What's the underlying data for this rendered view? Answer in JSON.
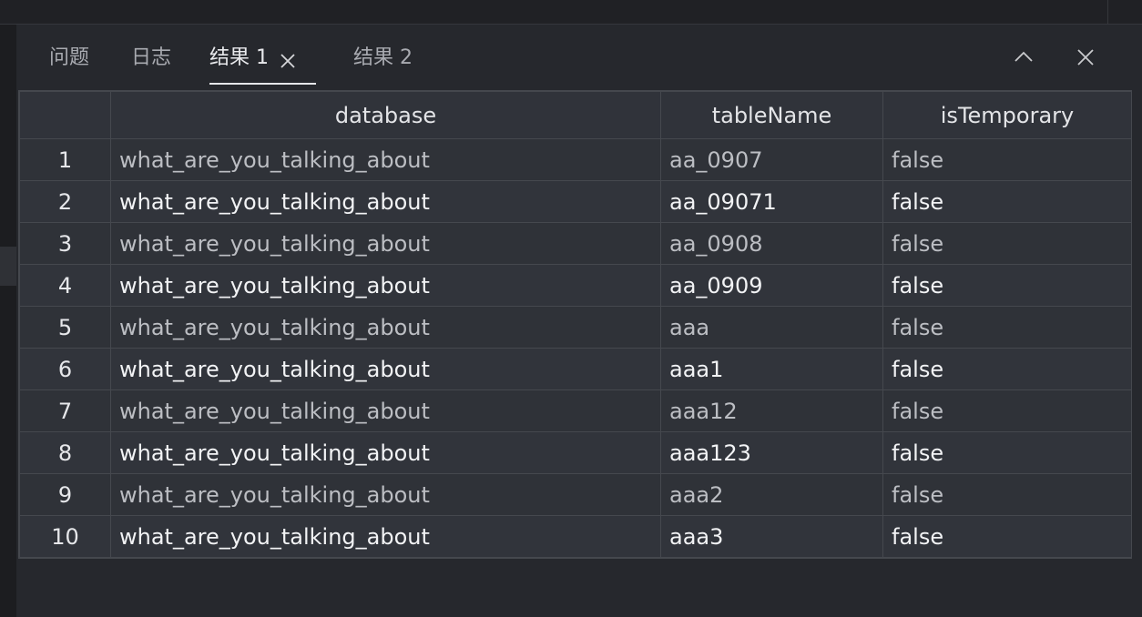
{
  "tabs": [
    {
      "label": "问题",
      "active": false
    },
    {
      "label": "日志",
      "active": false
    },
    {
      "label": "结果 1",
      "active": true,
      "closable": true
    },
    {
      "label": "结果 2",
      "active": false
    }
  ],
  "panel_controls": {
    "collapse_icon": "chevron-up-icon",
    "close_icon": "close-icon"
  },
  "result_table": {
    "columns": [
      "",
      "database",
      "tableName",
      "isTemporary"
    ],
    "rows": [
      {
        "index": "1",
        "database": "what_are_you_talking_about",
        "tableName": "aa_0907",
        "isTemporary": "false"
      },
      {
        "index": "2",
        "database": "what_are_you_talking_about",
        "tableName": "aa_09071",
        "isTemporary": "false"
      },
      {
        "index": "3",
        "database": "what_are_you_talking_about",
        "tableName": "aa_0908",
        "isTemporary": "false"
      },
      {
        "index": "4",
        "database": "what_are_you_talking_about",
        "tableName": "aa_0909",
        "isTemporary": "false"
      },
      {
        "index": "5",
        "database": "what_are_you_talking_about",
        "tableName": "aaa",
        "isTemporary": "false"
      },
      {
        "index": "6",
        "database": "what_are_you_talking_about",
        "tableName": "aaa1",
        "isTemporary": "false"
      },
      {
        "index": "7",
        "database": "what_are_you_talking_about",
        "tableName": "aaa12",
        "isTemporary": "false"
      },
      {
        "index": "8",
        "database": "what_are_you_talking_about",
        "tableName": "aaa123",
        "isTemporary": "false"
      },
      {
        "index": "9",
        "database": "what_are_you_talking_about",
        "tableName": "aaa2",
        "isTemporary": "false"
      },
      {
        "index": "10",
        "database": "what_are_you_talking_about",
        "tableName": "aaa3",
        "isTemporary": "false"
      }
    ]
  },
  "colors": {
    "background": "#26282d",
    "text_active": "#e8e9ec",
    "text_muted": "#a9abb1",
    "grid_border": "#45484e"
  }
}
